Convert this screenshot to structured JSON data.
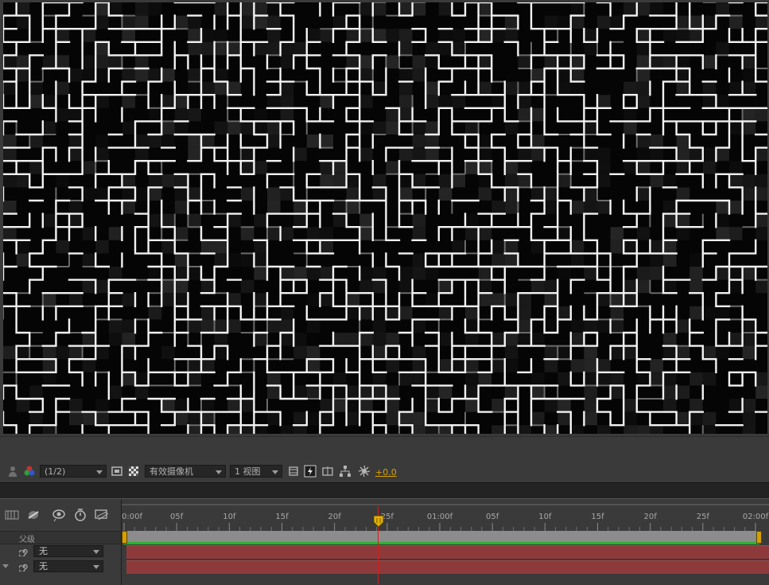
{
  "viewer": {
    "resolution": "(1/2)",
    "camera": "有效摄像机",
    "views": "1 视图",
    "exposure": "+0.0"
  },
  "icons": {
    "toolbar": [
      "user-icon",
      "color-channels-icon",
      "region-of-interest-icon",
      "transparency-grid-icon",
      "3d-draft-icon",
      "fast-preview-icon",
      "reset-view-icon",
      "flowchart-icon",
      "exposure-icon"
    ],
    "timeline_switches": [
      "comp-mini-flowchart-icon",
      "draft-3d-icon",
      "hide-shy-icon",
      "frame-blending-icon",
      "motion-blur-icon"
    ]
  },
  "timeline": {
    "ruler_labels": [
      "0:00f",
      "05f",
      "10f",
      "15f",
      "20f",
      "25f",
      "01:00f",
      "05f",
      "10f",
      "15f",
      "20f",
      "25f",
      "02:00f"
    ],
    "parent_header": "父级",
    "layers": [
      {
        "parent": "无"
      },
      {
        "parent": "无"
      }
    ],
    "current_time_fraction": 0.4,
    "colors": {
      "layer_bar": "#8e3a3b",
      "work_area": "#8c8c8c",
      "playhead": "#e01818",
      "handle": "#d3a100",
      "range_bar": "#27b52c"
    }
  }
}
